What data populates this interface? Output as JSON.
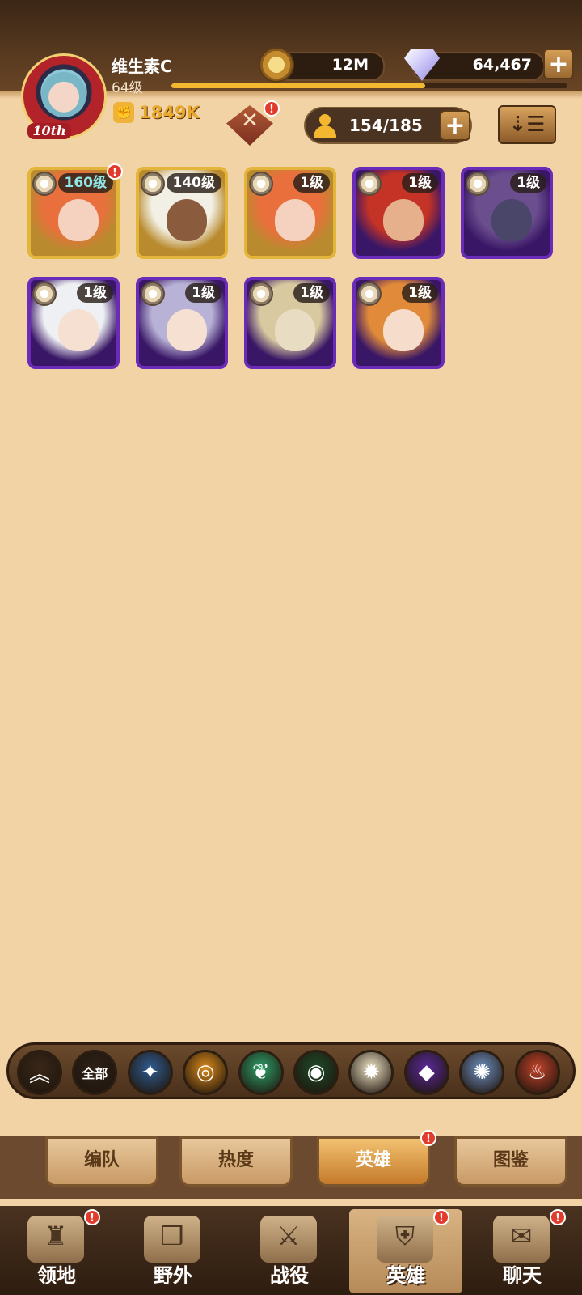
{
  "player": {
    "name": "维生素C",
    "level": "64级",
    "avatar_badge": "10th",
    "power": "1849K",
    "xp_fraction": 0.64
  },
  "currencies": {
    "gold": "12M",
    "gems": "64,467"
  },
  "roster": {
    "count": "154/185"
  },
  "heroes": [
    {
      "level": "160级",
      "frame": "gold",
      "alert": true,
      "hair": "#e9703c",
      "skin": "#f4d2bf",
      "teal": true
    },
    {
      "level": "140级",
      "frame": "gold",
      "alert": false,
      "hair": "#f2f0e4",
      "skin": "#8b5b3e",
      "teal": false
    },
    {
      "level": "1级",
      "frame": "gold",
      "alert": false,
      "hair": "#e9703c",
      "skin": "#f4d2bf",
      "teal": false
    },
    {
      "level": "1级",
      "frame": "purple",
      "alert": false,
      "hair": "#c53326",
      "skin": "#e6b08c",
      "teal": false
    },
    {
      "level": "1级",
      "frame": "purple",
      "alert": false,
      "hair": "#6b4e8e",
      "skin": "#49466a",
      "teal": false
    },
    {
      "level": "1级",
      "frame": "purple",
      "alert": false,
      "hair": "#eef0f4",
      "skin": "#f6e0d2",
      "teal": false
    },
    {
      "level": "1级",
      "frame": "purple",
      "alert": false,
      "hair": "#b8b2d6",
      "skin": "#f6e0d2",
      "teal": false
    },
    {
      "level": "1级",
      "frame": "purple",
      "alert": false,
      "hair": "#d9c9a0",
      "skin": "#e8dcc2",
      "teal": false
    },
    {
      "level": "1级",
      "frame": "purple",
      "alert": false,
      "hair": "#e08a3a",
      "skin": "#f6dccb",
      "teal": false
    }
  ],
  "filters": [
    {
      "label": "",
      "glyph": "︽",
      "icon": "collapse-chevron-icon",
      "color": "#3a2818"
    },
    {
      "label": "全部",
      "glyph": "",
      "icon": "all-factions-icon",
      "color": "#2e2218"
    },
    {
      "label": "",
      "glyph": "✦",
      "icon": "lightbearer-icon",
      "color": "#2f5c8f"
    },
    {
      "label": "",
      "glyph": "◎",
      "icon": "mauler-icon",
      "color": "#d98a1c"
    },
    {
      "label": "",
      "glyph": "❦",
      "icon": "wilder-icon",
      "color": "#2ea06a"
    },
    {
      "label": "",
      "glyph": "◉",
      "icon": "graveborn-icon",
      "color": "#1f4a2a"
    },
    {
      "label": "",
      "glyph": "✹",
      "icon": "celestial-icon",
      "color": "#f1e6c8"
    },
    {
      "label": "",
      "glyph": "◆",
      "icon": "hypogean-icon",
      "color": "#5b2a9a"
    },
    {
      "label": "",
      "glyph": "✺",
      "icon": "dimensional-icon",
      "color": "#6e8fc0"
    },
    {
      "label": "",
      "glyph": "♨",
      "icon": "dragon-icon",
      "color": "#c0432a"
    }
  ],
  "sub_tabs": [
    {
      "label": "编队",
      "active": false,
      "alert": false
    },
    {
      "label": "热度",
      "active": false,
      "alert": false
    },
    {
      "label": "英雄",
      "active": true,
      "alert": true
    },
    {
      "label": "图鉴",
      "active": false,
      "alert": false
    }
  ],
  "nav": [
    {
      "label": "领地",
      "glyph": "♜",
      "icon": "castle-icon",
      "active": false,
      "alert": true
    },
    {
      "label": "野外",
      "glyph": "❒",
      "icon": "map-scroll-icon",
      "active": false,
      "alert": false
    },
    {
      "label": "战役",
      "glyph": "⚔",
      "icon": "sword-icon",
      "active": false,
      "alert": false
    },
    {
      "label": "英雄",
      "glyph": "⛨",
      "icon": "helmet-icon",
      "active": true,
      "alert": true
    },
    {
      "label": "聊天",
      "glyph": "✉",
      "icon": "chat-icon",
      "active": false,
      "alert": true
    }
  ],
  "alert_mark": "!",
  "colors": {
    "gold_frame": "#e3b53a",
    "purple_frame": "#6a2bb8",
    "alert": "#e23a2b",
    "accent": "#f3b82f"
  }
}
